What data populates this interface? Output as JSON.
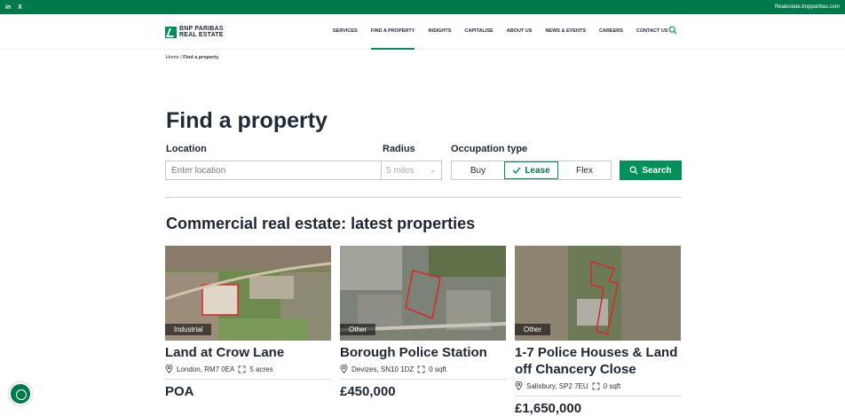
{
  "topbar": {
    "linkedin": "in",
    "x": "X",
    "site_link": "Realestate.bnpparibas.com"
  },
  "logo": {
    "line1": "BNP PARIBAS",
    "line2": "REAL ESTATE"
  },
  "nav": {
    "items": [
      "SERVICES",
      "FIND A PROPERTY",
      "INSIGHTS",
      "CAPITALISE",
      "ABOUT US",
      "NEWS & EVENTS",
      "CAREERS",
      "CONTACT US"
    ],
    "active": "FIND A PROPERTY"
  },
  "breadcrumb": {
    "home": "Home",
    "separator": "|",
    "current": "Find a property"
  },
  "page": {
    "title": "Find a property"
  },
  "search": {
    "location_label": "Location",
    "location_placeholder": "Enter location",
    "radius_label": "Radius",
    "radius_value": "5 miles",
    "occupation_label": "Occupation type",
    "options": [
      "Buy",
      "Lease",
      "Flex"
    ],
    "selected": "Lease",
    "button": "Search"
  },
  "listing": {
    "heading": "Commercial real estate: latest properties",
    "cards": [
      {
        "tag": "Industrial",
        "name": "Land at Crow Lane",
        "location": "London, RM7 0EA",
        "size": "5 acres",
        "price": "POA"
      },
      {
        "tag": "Other",
        "name": "Borough Police Station",
        "location": "Devizes, SN10 1DZ",
        "size": "0 sqft",
        "price": "£450,000"
      },
      {
        "tag": "Other",
        "name": "1-7 Police Houses & Land off Chancery Close",
        "location": "Salisbury, SP2 7EU",
        "size": "0 sqft",
        "price": "£1,650,000"
      }
    ]
  },
  "colors": {
    "brand": "#00915a",
    "topbar": "#00794a"
  }
}
